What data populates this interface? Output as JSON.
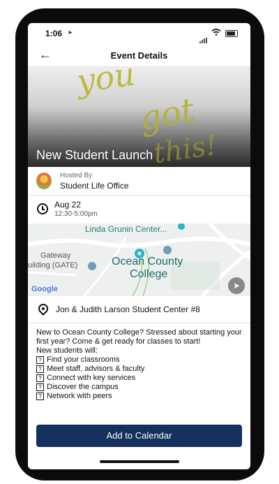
{
  "status": {
    "time": "1:06"
  },
  "nav": {
    "title": "Event Details"
  },
  "hero": {
    "title": "New Student Launch"
  },
  "host": {
    "label": "Hosted By",
    "name": "Student Life Office"
  },
  "schedule": {
    "date": "Aug 22",
    "time": "12:30-5:00pm"
  },
  "map": {
    "label_center": "Linda Grunin Center...",
    "label_college_line1": "Ocean County",
    "label_college_line2": "College",
    "label_gateway_line1": "Gateway",
    "label_gateway_line2": "uilding (GATE)",
    "attribution": "Google"
  },
  "location": {
    "address": "Jon & Judith Larson Student Center #8"
  },
  "description": {
    "intro": "New to Ocean County College? Stressed about starting your first year? Come & get ready for classes to start!",
    "subheading": "New students will:",
    "items": [
      "Find your classrooms",
      "Meet staff, advisors & faculty",
      "Connect with key services",
      "Discover the campus",
      "Network with peers"
    ]
  },
  "cta": {
    "label": "Add to Calendar"
  },
  "colors": {
    "primary": "#13315c",
    "map_teal": "#1f6a6a"
  }
}
